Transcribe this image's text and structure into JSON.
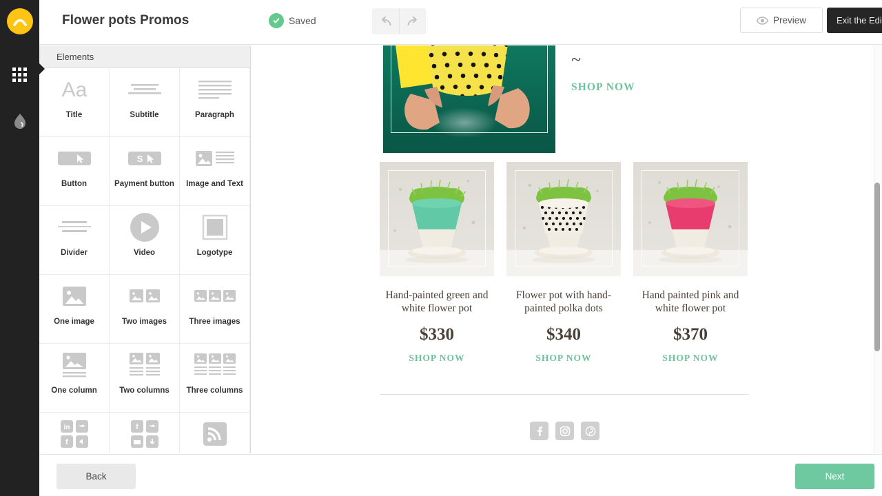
{
  "brand": {
    "logo_icon": "arch-logo-icon",
    "logo_color": "#ffc414"
  },
  "rail": {
    "items": [
      {
        "icon": "grid-apps-icon",
        "name": "elements",
        "active": true
      },
      {
        "icon": "droplet-paint-icon",
        "name": "design",
        "active": false
      }
    ]
  },
  "topbar": {
    "site_title": "Flower pots Promos",
    "save_status": "Saved",
    "save_icon": "check-circle-icon",
    "save_color": "#63c98d",
    "undo_icon": "undo-arrow-icon",
    "redo_icon": "redo-arrow-icon",
    "preview_label": "Preview",
    "preview_icon": "eye-icon",
    "exit_label": "Exit the Editor",
    "exit_icon": "triangle-left-icon"
  },
  "panel": {
    "header": "Elements",
    "elements": [
      {
        "label": "Title",
        "icon": "title-aa-icon"
      },
      {
        "label": "Subtitle",
        "icon": "subtitle-lines-icon"
      },
      {
        "label": "Paragraph",
        "icon": "paragraph-lines-icon"
      },
      {
        "label": "Button",
        "icon": "button-cursor-icon"
      },
      {
        "label": "Payment button",
        "icon": "payment-button-icon"
      },
      {
        "label": "Image and Text",
        "icon": "image-and-text-icon"
      },
      {
        "label": "Divider",
        "icon": "divider-icon"
      },
      {
        "label": "Video",
        "icon": "video-play-icon"
      },
      {
        "label": "Logotype",
        "icon": "logotype-square-icon"
      },
      {
        "label": "One image",
        "icon": "one-image-icon"
      },
      {
        "label": "Two images",
        "icon": "two-images-icon"
      },
      {
        "label": "Three images",
        "icon": "three-images-icon"
      },
      {
        "label": "One column",
        "icon": "one-column-icon"
      },
      {
        "label": "Two columns",
        "icon": "two-columns-icon"
      },
      {
        "label": "Three columns",
        "icon": "three-columns-icon"
      },
      {
        "label": "",
        "icon": "social-linkedin-twitter-icon"
      },
      {
        "label": "",
        "icon": "social-facebook-twitter-icon"
      },
      {
        "label": "",
        "icon": "rss-feed-icon"
      }
    ]
  },
  "canvas": {
    "hero": {
      "image_alt": "yellow perforated flower pot held in hands on green background",
      "divider_glyph": "~",
      "shop_label": "SHOP NOW"
    },
    "products": [
      {
        "title": "Hand-painted green and white flower pot",
        "price": "$330",
        "shop_label": "SHOP NOW",
        "pot_color": "#62c9a6"
      },
      {
        "title": "Flower pot with hand-painted polka dots",
        "price": "$340",
        "shop_label": "SHOP NOW",
        "pot_color": "#f2efe8"
      },
      {
        "title": "Hand painted pink and white flower pot",
        "price": "$370",
        "shop_label": "SHOP NOW",
        "pot_color": "#e83c6e"
      }
    ],
    "socials": [
      {
        "icon": "facebook-icon"
      },
      {
        "icon": "instagram-icon"
      },
      {
        "icon": "pinterest-icon"
      }
    ],
    "link_color": "#6cc39a"
  },
  "bottombar": {
    "back_label": "Back",
    "next_label": "Next",
    "next_color": "#6ec9a0"
  }
}
